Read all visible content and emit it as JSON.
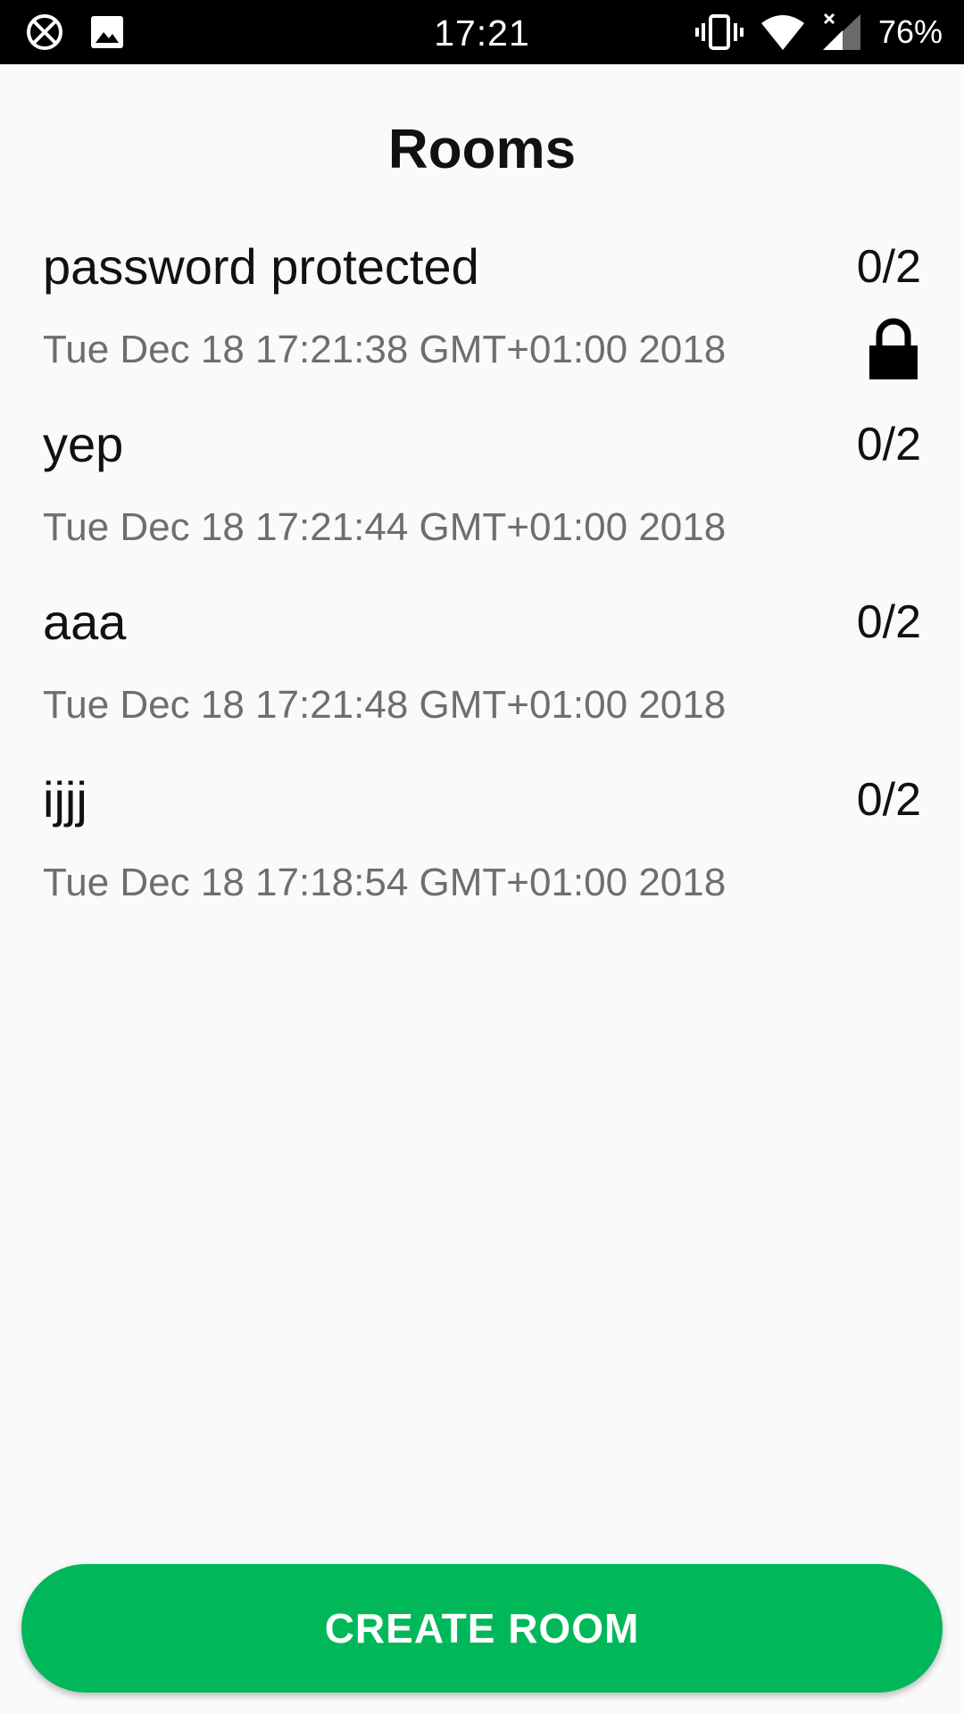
{
  "status_bar": {
    "time": "17:21",
    "battery": "76%",
    "icons": [
      "no-disturb-icon",
      "image-icon",
      "vibrate-icon",
      "wifi-icon",
      "signal-icon"
    ]
  },
  "header": {
    "title": "Rooms"
  },
  "rooms": [
    {
      "name": "password protected",
      "occupancy": "0/2",
      "created": "Tue Dec 18 17:21:38 GMT+01:00 2018",
      "locked": true
    },
    {
      "name": "yep",
      "occupancy": "0/2",
      "created": "Tue Dec 18 17:21:44 GMT+01:00 2018",
      "locked": false
    },
    {
      "name": "aaa",
      "occupancy": "0/2",
      "created": "Tue Dec 18 17:21:48 GMT+01:00 2018",
      "locked": false
    },
    {
      "name": "ijjj",
      "occupancy": "0/2",
      "created": "Tue Dec 18 17:18:54 GMT+01:00 2018",
      "locked": false
    }
  ],
  "actions": {
    "create_room_label": "CREATE ROOM"
  },
  "colors": {
    "accent": "#00b85a",
    "status_bar": "#000000",
    "background": "#fafafa",
    "secondary_text": "#6e6e6e"
  }
}
